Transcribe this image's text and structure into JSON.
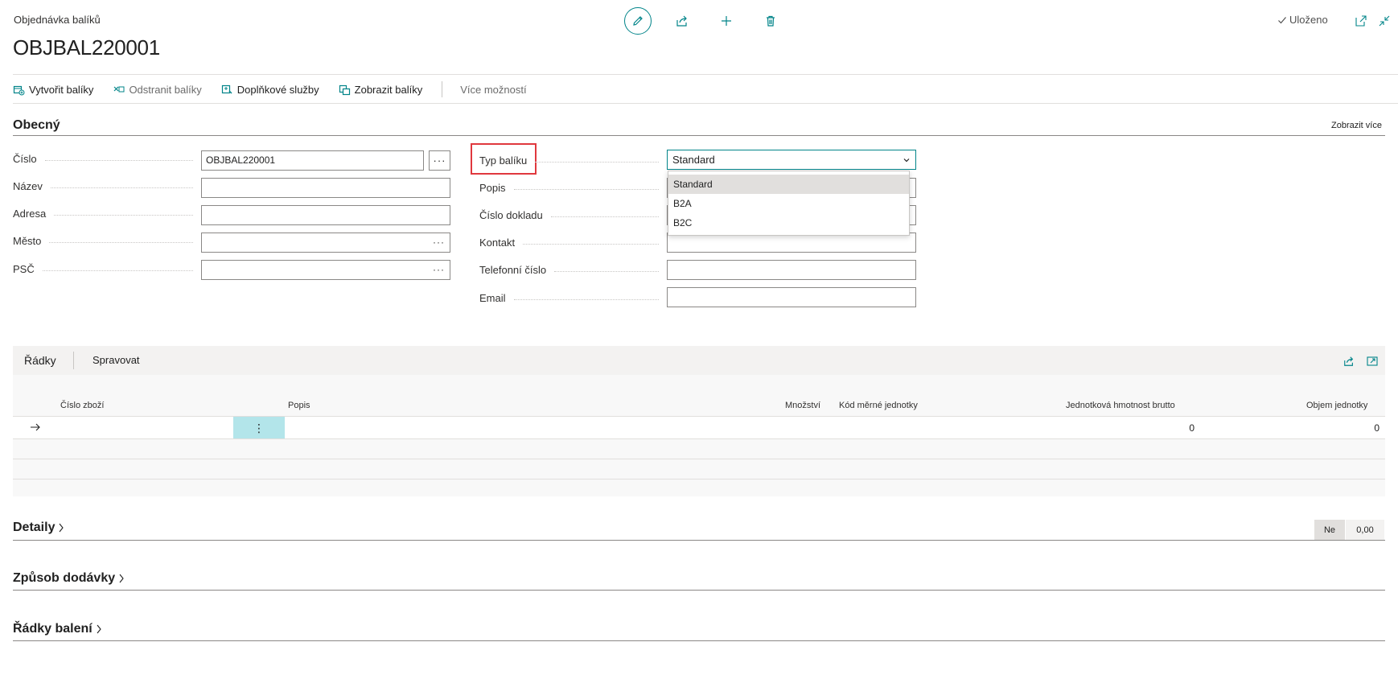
{
  "header": {
    "breadcrumb": "Objednávka balíků",
    "title": "OBJBAL220001",
    "status": "Uloženo"
  },
  "actions": {
    "create": "Vytvořit balíky",
    "remove": "Odstranit balíky",
    "extra": "Doplňkové služby",
    "show": "Zobrazit balíky",
    "more": "Více možností"
  },
  "general": {
    "title": "Obecný",
    "show_more": "Zobrazit více",
    "fields_left": [
      {
        "label": "Číslo",
        "value": "OBJBAL220001"
      },
      {
        "label": "Název",
        "value": ""
      },
      {
        "label": "Adresa",
        "value": ""
      },
      {
        "label": "Město",
        "value": ""
      },
      {
        "label": "PSČ",
        "value": ""
      }
    ],
    "fields_right": [
      {
        "label": "Typ balíku",
        "value": "Standard"
      },
      {
        "label": "Popis",
        "value": ""
      },
      {
        "label": "Číslo dokladu",
        "value": ""
      },
      {
        "label": "Kontakt",
        "value": ""
      },
      {
        "label": "Telefonní číslo",
        "value": ""
      },
      {
        "label": "Email",
        "value": ""
      }
    ],
    "dropdown_options": [
      "Standard",
      "B2A",
      "B2C"
    ]
  },
  "lines": {
    "tab_lines": "Řádky",
    "tab_manage": "Spravovat",
    "columns": [
      "Číslo zboží",
      "Popis",
      "Množství",
      "Kód měrné jednotky",
      "Jednotková hmotnost brutto",
      "Objem jednotky"
    ],
    "row": {
      "gross_weight": "0",
      "volume": "0"
    }
  },
  "sections": {
    "details": "Detaily",
    "details_flag": "Ne",
    "details_value": "0,00",
    "delivery": "Způsob dodávky",
    "packing_lines": "Řádky balení"
  },
  "colors": {
    "accent": "#008489",
    "highlight": "#e0383e",
    "selected_cell": "#b3e5ea"
  }
}
